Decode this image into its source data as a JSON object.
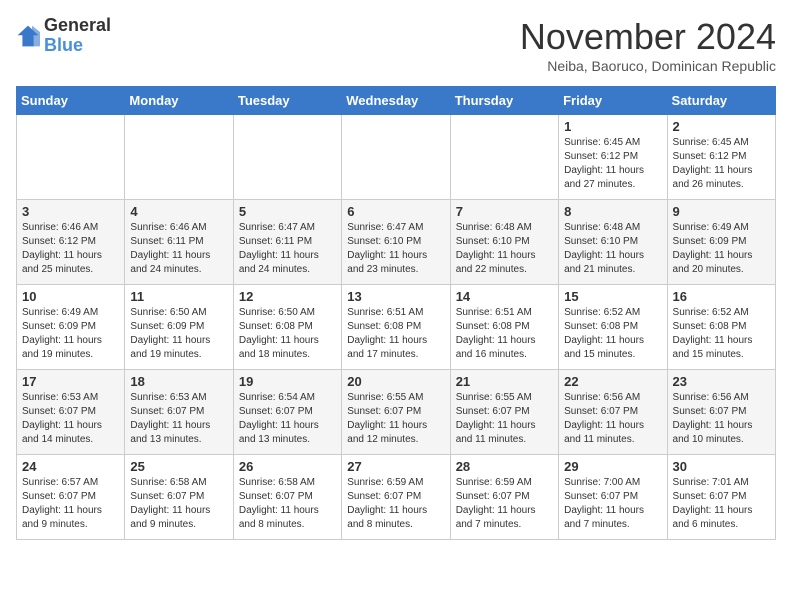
{
  "header": {
    "logo_general": "General",
    "logo_blue": "Blue",
    "month_year": "November 2024",
    "location": "Neiba, Baoruco, Dominican Republic"
  },
  "weekdays": [
    "Sunday",
    "Monday",
    "Tuesday",
    "Wednesday",
    "Thursday",
    "Friday",
    "Saturday"
  ],
  "weeks": [
    [
      {
        "day": "",
        "info": ""
      },
      {
        "day": "",
        "info": ""
      },
      {
        "day": "",
        "info": ""
      },
      {
        "day": "",
        "info": ""
      },
      {
        "day": "",
        "info": ""
      },
      {
        "day": "1",
        "info": "Sunrise: 6:45 AM\nSunset: 6:12 PM\nDaylight: 11 hours\nand 27 minutes."
      },
      {
        "day": "2",
        "info": "Sunrise: 6:45 AM\nSunset: 6:12 PM\nDaylight: 11 hours\nand 26 minutes."
      }
    ],
    [
      {
        "day": "3",
        "info": "Sunrise: 6:46 AM\nSunset: 6:12 PM\nDaylight: 11 hours\nand 25 minutes."
      },
      {
        "day": "4",
        "info": "Sunrise: 6:46 AM\nSunset: 6:11 PM\nDaylight: 11 hours\nand 24 minutes."
      },
      {
        "day": "5",
        "info": "Sunrise: 6:47 AM\nSunset: 6:11 PM\nDaylight: 11 hours\nand 24 minutes."
      },
      {
        "day": "6",
        "info": "Sunrise: 6:47 AM\nSunset: 6:10 PM\nDaylight: 11 hours\nand 23 minutes."
      },
      {
        "day": "7",
        "info": "Sunrise: 6:48 AM\nSunset: 6:10 PM\nDaylight: 11 hours\nand 22 minutes."
      },
      {
        "day": "8",
        "info": "Sunrise: 6:48 AM\nSunset: 6:10 PM\nDaylight: 11 hours\nand 21 minutes."
      },
      {
        "day": "9",
        "info": "Sunrise: 6:49 AM\nSunset: 6:09 PM\nDaylight: 11 hours\nand 20 minutes."
      }
    ],
    [
      {
        "day": "10",
        "info": "Sunrise: 6:49 AM\nSunset: 6:09 PM\nDaylight: 11 hours\nand 19 minutes."
      },
      {
        "day": "11",
        "info": "Sunrise: 6:50 AM\nSunset: 6:09 PM\nDaylight: 11 hours\nand 19 minutes."
      },
      {
        "day": "12",
        "info": "Sunrise: 6:50 AM\nSunset: 6:08 PM\nDaylight: 11 hours\nand 18 minutes."
      },
      {
        "day": "13",
        "info": "Sunrise: 6:51 AM\nSunset: 6:08 PM\nDaylight: 11 hours\nand 17 minutes."
      },
      {
        "day": "14",
        "info": "Sunrise: 6:51 AM\nSunset: 6:08 PM\nDaylight: 11 hours\nand 16 minutes."
      },
      {
        "day": "15",
        "info": "Sunrise: 6:52 AM\nSunset: 6:08 PM\nDaylight: 11 hours\nand 15 minutes."
      },
      {
        "day": "16",
        "info": "Sunrise: 6:52 AM\nSunset: 6:08 PM\nDaylight: 11 hours\nand 15 minutes."
      }
    ],
    [
      {
        "day": "17",
        "info": "Sunrise: 6:53 AM\nSunset: 6:07 PM\nDaylight: 11 hours\nand 14 minutes."
      },
      {
        "day": "18",
        "info": "Sunrise: 6:53 AM\nSunset: 6:07 PM\nDaylight: 11 hours\nand 13 minutes."
      },
      {
        "day": "19",
        "info": "Sunrise: 6:54 AM\nSunset: 6:07 PM\nDaylight: 11 hours\nand 13 minutes."
      },
      {
        "day": "20",
        "info": "Sunrise: 6:55 AM\nSunset: 6:07 PM\nDaylight: 11 hours\nand 12 minutes."
      },
      {
        "day": "21",
        "info": "Sunrise: 6:55 AM\nSunset: 6:07 PM\nDaylight: 11 hours\nand 11 minutes."
      },
      {
        "day": "22",
        "info": "Sunrise: 6:56 AM\nSunset: 6:07 PM\nDaylight: 11 hours\nand 11 minutes."
      },
      {
        "day": "23",
        "info": "Sunrise: 6:56 AM\nSunset: 6:07 PM\nDaylight: 11 hours\nand 10 minutes."
      }
    ],
    [
      {
        "day": "24",
        "info": "Sunrise: 6:57 AM\nSunset: 6:07 PM\nDaylight: 11 hours\nand 9 minutes."
      },
      {
        "day": "25",
        "info": "Sunrise: 6:58 AM\nSunset: 6:07 PM\nDaylight: 11 hours\nand 9 minutes."
      },
      {
        "day": "26",
        "info": "Sunrise: 6:58 AM\nSunset: 6:07 PM\nDaylight: 11 hours\nand 8 minutes."
      },
      {
        "day": "27",
        "info": "Sunrise: 6:59 AM\nSunset: 6:07 PM\nDaylight: 11 hours\nand 8 minutes."
      },
      {
        "day": "28",
        "info": "Sunrise: 6:59 AM\nSunset: 6:07 PM\nDaylight: 11 hours\nand 7 minutes."
      },
      {
        "day": "29",
        "info": "Sunrise: 7:00 AM\nSunset: 6:07 PM\nDaylight: 11 hours\nand 7 minutes."
      },
      {
        "day": "30",
        "info": "Sunrise: 7:01 AM\nSunset: 6:07 PM\nDaylight: 11 hours\nand 6 minutes."
      }
    ]
  ]
}
